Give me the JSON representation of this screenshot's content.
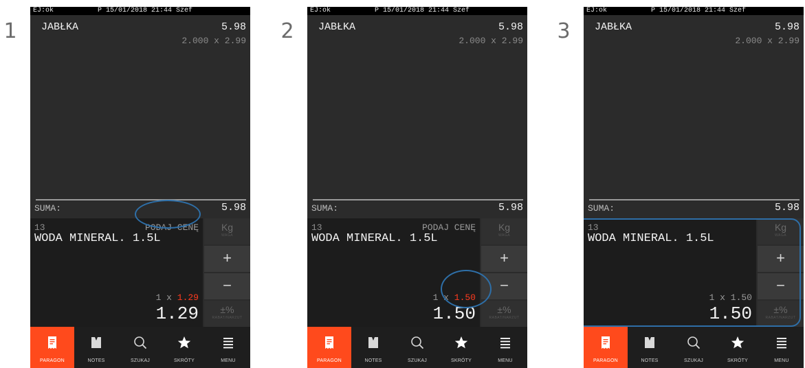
{
  "steps": [
    {
      "step_label": "1",
      "status": {
        "left": "EJ:ok",
        "right": "P 15/01/2018 21:44 Szef"
      },
      "receipt": {
        "item_name": "JABŁKA",
        "item_total": "5.98",
        "item_detail": "2.000 x 2.99"
      },
      "sum": {
        "label": "SUMA:",
        "value": "5.98"
      },
      "entry": {
        "plu": "13",
        "prompt": "PODAJ CENĘ",
        "product": "WODA MINERAL. 1.5L",
        "qty_prefix": "1 x ",
        "qty_price": "1.29",
        "qty_price_highlighted": true,
        "big_price": "1.29"
      },
      "highlight": "prompt"
    },
    {
      "step_label": "2",
      "status": {
        "left": "EJ:ok",
        "right": "P 15/01/2018 21:44 Szef"
      },
      "receipt": {
        "item_name": "JABŁKA",
        "item_total": "5.98",
        "item_detail": "2.000 x 2.99"
      },
      "sum": {
        "label": "SUMA:",
        "value": "5.98"
      },
      "entry": {
        "plu": "13",
        "prompt": "PODAJ CENĘ",
        "product": "WODA MINERAL. 1.5L",
        "qty_prefix": "1 x ",
        "qty_price": "1.50",
        "qty_price_highlighted": true,
        "big_price": "1.50"
      },
      "highlight": "price"
    },
    {
      "step_label": "3",
      "status": {
        "left": "EJ:ok",
        "right": "P 15/01/2018 21:44 Szef"
      },
      "receipt": {
        "item_name": "JABŁKA",
        "item_total": "5.98",
        "item_detail": "2.000 x 2.99"
      },
      "sum": {
        "label": "SUMA:",
        "value": "5.98"
      },
      "entry": {
        "plu": "13",
        "prompt": "",
        "product": "WODA MINERAL. 1.5L",
        "qty_prefix": "1 x ",
        "qty_price": "1.50",
        "qty_price_highlighted": false,
        "big_price": "1.50"
      },
      "highlight": "panel"
    }
  ],
  "side_buttons": {
    "weight": {
      "main": "Kg",
      "sub": "WAGA"
    },
    "plus": {
      "main": "+"
    },
    "minus": {
      "main": "−"
    },
    "discount": {
      "main": "±%",
      "sub": "RABAT/NARZUT"
    }
  },
  "nav": [
    {
      "label": "PARAGON",
      "icon": "receipt-icon",
      "active": true
    },
    {
      "label": "NOTES",
      "icon": "notes-icon",
      "active": false
    },
    {
      "label": "SZUKAJ",
      "icon": "search-icon",
      "active": false
    },
    {
      "label": "SKRÓTY",
      "icon": "star-icon",
      "active": false
    },
    {
      "label": "MENU",
      "icon": "menu-icon",
      "active": false
    }
  ],
  "colors": {
    "accent": "#ff4a1c",
    "price_highlight": "#ff3b1f",
    "annotation": "#2e6fa8",
    "screen_bg": "#2b2b2b",
    "entry_bg": "#1c1c1c"
  }
}
